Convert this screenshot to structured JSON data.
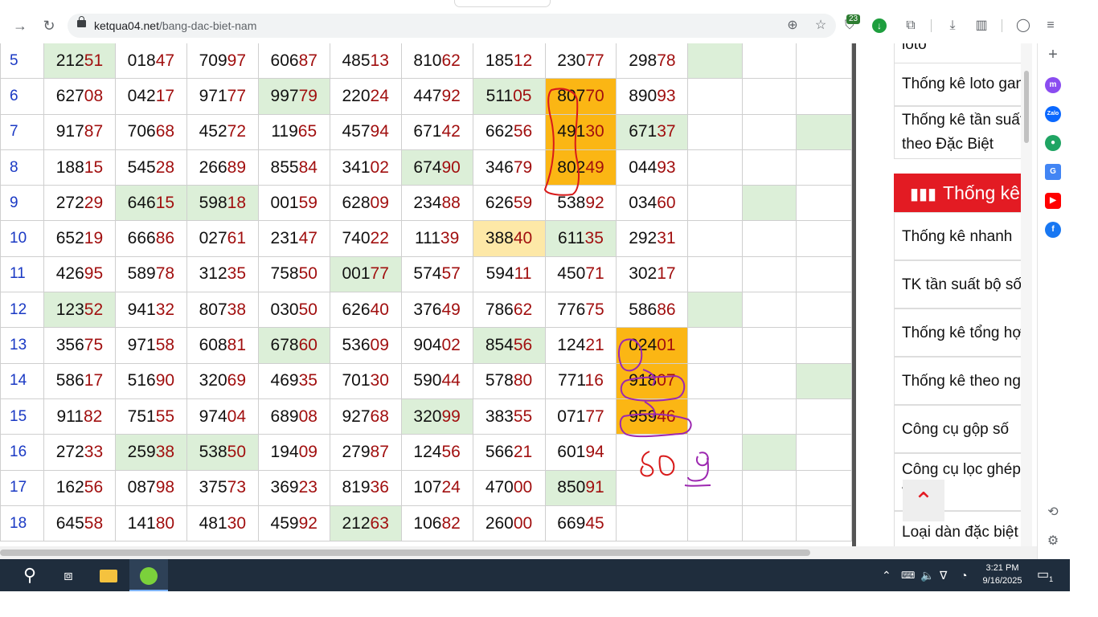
{
  "browser": {
    "url_host": "ketqua04.net",
    "url_path": "/bang-dac-biet-nam",
    "extension_badge": "23"
  },
  "table": {
    "rows": [
      {
        "no": "5",
        "cells": [
          {
            "head": "212",
            "tail": "51",
            "bg": "g"
          },
          {
            "head": "018",
            "tail": "47"
          },
          {
            "head": "709",
            "tail": "97"
          },
          {
            "head": "606",
            "tail": "87"
          },
          {
            "head": "485",
            "tail": "13"
          },
          {
            "head": "810",
            "tail": "62"
          },
          {
            "head": "185",
            "tail": "12"
          },
          {
            "head": "230",
            "tail": "77"
          },
          {
            "head": "298",
            "tail": "78"
          },
          {
            "head": "",
            "tail": "",
            "bg": "g"
          },
          {
            "head": "",
            "tail": ""
          },
          {
            "head": "",
            "tail": ""
          }
        ]
      },
      {
        "no": "6",
        "cells": [
          {
            "head": "627",
            "tail": "08"
          },
          {
            "head": "042",
            "tail": "17"
          },
          {
            "head": "971",
            "tail": "77"
          },
          {
            "head": "997",
            "tail": "79",
            "bg": "g"
          },
          {
            "head": "220",
            "tail": "24"
          },
          {
            "head": "447",
            "tail": "92"
          },
          {
            "head": "511",
            "tail": "05",
            "bg": "g"
          },
          {
            "head": "807",
            "tail": "70",
            "bg": "o"
          },
          {
            "head": "890",
            "tail": "93"
          },
          {
            "head": "",
            "tail": ""
          },
          {
            "head": "",
            "tail": ""
          },
          {
            "head": "",
            "tail": ""
          }
        ]
      },
      {
        "no": "7",
        "cells": [
          {
            "head": "917",
            "tail": "87"
          },
          {
            "head": "706",
            "tail": "68"
          },
          {
            "head": "452",
            "tail": "72"
          },
          {
            "head": "119",
            "tail": "65"
          },
          {
            "head": "457",
            "tail": "94"
          },
          {
            "head": "671",
            "tail": "42"
          },
          {
            "head": "662",
            "tail": "56"
          },
          {
            "head": "491",
            "tail": "30",
            "bg": "o"
          },
          {
            "head": "671",
            "tail": "37",
            "bg": "g"
          },
          {
            "head": "",
            "tail": ""
          },
          {
            "head": "",
            "tail": ""
          },
          {
            "head": "",
            "tail": "",
            "bg": "g"
          }
        ]
      },
      {
        "no": "8",
        "cells": [
          {
            "head": "188",
            "tail": "15"
          },
          {
            "head": "545",
            "tail": "28"
          },
          {
            "head": "266",
            "tail": "89"
          },
          {
            "head": "855",
            "tail": "84"
          },
          {
            "head": "341",
            "tail": "02"
          },
          {
            "head": "674",
            "tail": "90",
            "bg": "g"
          },
          {
            "head": "346",
            "tail": "79"
          },
          {
            "head": "802",
            "tail": "49",
            "bg": "o"
          },
          {
            "head": "044",
            "tail": "93"
          },
          {
            "head": "",
            "tail": ""
          },
          {
            "head": "",
            "tail": ""
          },
          {
            "head": "",
            "tail": ""
          }
        ]
      },
      {
        "no": "9",
        "cells": [
          {
            "head": "272",
            "tail": "29"
          },
          {
            "head": "646",
            "tail": "15",
            "bg": "g"
          },
          {
            "head": "598",
            "tail": "18",
            "bg": "g"
          },
          {
            "head": "001",
            "tail": "59"
          },
          {
            "head": "628",
            "tail": "09"
          },
          {
            "head": "234",
            "tail": "88"
          },
          {
            "head": "626",
            "tail": "59"
          },
          {
            "head": "538",
            "tail": "92"
          },
          {
            "head": "034",
            "tail": "60"
          },
          {
            "head": "",
            "tail": ""
          },
          {
            "head": "",
            "tail": "",
            "bg": "g"
          },
          {
            "head": "",
            "tail": ""
          }
        ]
      },
      {
        "no": "10",
        "cells": [
          {
            "head": "652",
            "tail": "19"
          },
          {
            "head": "666",
            "tail": "86"
          },
          {
            "head": "027",
            "tail": "61"
          },
          {
            "head": "231",
            "tail": "47"
          },
          {
            "head": "740",
            "tail": "22"
          },
          {
            "head": "111",
            "tail": "39"
          },
          {
            "head": "388",
            "tail": "40",
            "bg": "y"
          },
          {
            "head": "611",
            "tail": "35",
            "bg": "g"
          },
          {
            "head": "292",
            "tail": "31"
          },
          {
            "head": "",
            "tail": ""
          },
          {
            "head": "",
            "tail": ""
          },
          {
            "head": "",
            "tail": ""
          }
        ]
      },
      {
        "no": "11",
        "cells": [
          {
            "head": "426",
            "tail": "95"
          },
          {
            "head": "589",
            "tail": "78"
          },
          {
            "head": "312",
            "tail": "35"
          },
          {
            "head": "758",
            "tail": "50"
          },
          {
            "head": "001",
            "tail": "77",
            "bg": "g"
          },
          {
            "head": "574",
            "tail": "57"
          },
          {
            "head": "594",
            "tail": "11"
          },
          {
            "head": "450",
            "tail": "71"
          },
          {
            "head": "302",
            "tail": "17"
          },
          {
            "head": "",
            "tail": ""
          },
          {
            "head": "",
            "tail": ""
          },
          {
            "head": "",
            "tail": ""
          }
        ]
      },
      {
        "no": "12",
        "cells": [
          {
            "head": "123",
            "tail": "52",
            "bg": "g"
          },
          {
            "head": "941",
            "tail": "32"
          },
          {
            "head": "807",
            "tail": "38"
          },
          {
            "head": "030",
            "tail": "50"
          },
          {
            "head": "626",
            "tail": "40"
          },
          {
            "head": "376",
            "tail": "49"
          },
          {
            "head": "786",
            "tail": "62"
          },
          {
            "head": "776",
            "tail": "75"
          },
          {
            "head": "586",
            "tail": "86"
          },
          {
            "head": "",
            "tail": "",
            "bg": "g"
          },
          {
            "head": "",
            "tail": ""
          },
          {
            "head": "",
            "tail": ""
          }
        ]
      },
      {
        "no": "13",
        "cells": [
          {
            "head": "356",
            "tail": "75"
          },
          {
            "head": "971",
            "tail": "58"
          },
          {
            "head": "608",
            "tail": "81"
          },
          {
            "head": "678",
            "tail": "60",
            "bg": "g"
          },
          {
            "head": "536",
            "tail": "09"
          },
          {
            "head": "904",
            "tail": "02"
          },
          {
            "head": "854",
            "tail": "56",
            "bg": "g"
          },
          {
            "head": "124",
            "tail": "21"
          },
          {
            "head": "024",
            "tail": "01",
            "bg": "o"
          },
          {
            "head": "",
            "tail": ""
          },
          {
            "head": "",
            "tail": ""
          },
          {
            "head": "",
            "tail": ""
          }
        ]
      },
      {
        "no": "14",
        "cells": [
          {
            "head": "586",
            "tail": "17"
          },
          {
            "head": "516",
            "tail": "90"
          },
          {
            "head": "320",
            "tail": "69"
          },
          {
            "head": "469",
            "tail": "35"
          },
          {
            "head": "701",
            "tail": "30"
          },
          {
            "head": "590",
            "tail": "44"
          },
          {
            "head": "578",
            "tail": "80"
          },
          {
            "head": "771",
            "tail": "16"
          },
          {
            "head": "918",
            "tail": "07",
            "bg": "o"
          },
          {
            "head": "",
            "tail": ""
          },
          {
            "head": "",
            "tail": ""
          },
          {
            "head": "",
            "tail": "",
            "bg": "g"
          }
        ]
      },
      {
        "no": "15",
        "cells": [
          {
            "head": "911",
            "tail": "82"
          },
          {
            "head": "751",
            "tail": "55"
          },
          {
            "head": "974",
            "tail": "04"
          },
          {
            "head": "689",
            "tail": "08"
          },
          {
            "head": "927",
            "tail": "68"
          },
          {
            "head": "320",
            "tail": "99",
            "bg": "g"
          },
          {
            "head": "383",
            "tail": "55"
          },
          {
            "head": "071",
            "tail": "77"
          },
          {
            "head": "959",
            "tail": "46",
            "bg": "o"
          },
          {
            "head": "",
            "tail": ""
          },
          {
            "head": "",
            "tail": ""
          },
          {
            "head": "",
            "tail": ""
          }
        ]
      },
      {
        "no": "16",
        "cells": [
          {
            "head": "272",
            "tail": "33"
          },
          {
            "head": "259",
            "tail": "38",
            "bg": "g"
          },
          {
            "head": "538",
            "tail": "50",
            "bg": "g"
          },
          {
            "head": "194",
            "tail": "09"
          },
          {
            "head": "279",
            "tail": "87"
          },
          {
            "head": "124",
            "tail": "56"
          },
          {
            "head": "566",
            "tail": "21"
          },
          {
            "head": "601",
            "tail": "94"
          },
          {
            "head": "",
            "tail": ""
          },
          {
            "head": "",
            "tail": ""
          },
          {
            "head": "",
            "tail": "",
            "bg": "g"
          },
          {
            "head": "",
            "tail": ""
          }
        ]
      },
      {
        "no": "17",
        "cells": [
          {
            "head": "162",
            "tail": "56"
          },
          {
            "head": "087",
            "tail": "98"
          },
          {
            "head": "375",
            "tail": "73"
          },
          {
            "head": "369",
            "tail": "23"
          },
          {
            "head": "819",
            "tail": "36"
          },
          {
            "head": "107",
            "tail": "24"
          },
          {
            "head": "470",
            "tail": "00"
          },
          {
            "head": "850",
            "tail": "91",
            "bg": "g"
          },
          {
            "head": "",
            "tail": ""
          },
          {
            "head": "",
            "tail": ""
          },
          {
            "head": "",
            "tail": ""
          },
          {
            "head": "",
            "tail": ""
          }
        ]
      },
      {
        "no": "18",
        "cells": [
          {
            "head": "645",
            "tail": "58"
          },
          {
            "head": "141",
            "tail": "80"
          },
          {
            "head": "481",
            "tail": "30"
          },
          {
            "head": "459",
            "tail": "92"
          },
          {
            "head": "212",
            "tail": "63",
            "bg": "g"
          },
          {
            "head": "106",
            "tail": "82"
          },
          {
            "head": "260",
            "tail": "00"
          },
          {
            "head": "669",
            "tail": "45"
          },
          {
            "head": "",
            "tail": ""
          },
          {
            "head": "",
            "tail": ""
          },
          {
            "head": "",
            "tail": ""
          },
          {
            "head": "",
            "tail": ""
          }
        ]
      }
    ]
  },
  "sidebar": {
    "items": [
      {
        "label": "loto"
      },
      {
        "label": "Thống kê loto gan"
      },
      {
        "label": "Thống kê tần suất theo Đặc Biệt"
      },
      {
        "label": "Thống kê"
      },
      {
        "label": "Thống kê nhanh"
      },
      {
        "label": "TK tần suất bộ số"
      },
      {
        "label": "Thống kê tổng hợp"
      },
      {
        "label": "Thống kê theo ngày"
      },
      {
        "label": "Công cụ gộp số"
      },
      {
        "label": "Công cụ lọc ghép VIP"
      },
      {
        "label": "Loại dàn đặc biệt"
      }
    ]
  },
  "taskbar": {
    "time": "3:21 PM",
    "date": "9/16/2025",
    "notification_count": "1"
  },
  "colors": {
    "green_cell": "#dcefd8",
    "orange_cell": "#fbb614",
    "yellow_cell": "#fde8a7",
    "tail_red": "#a10f0f",
    "row_number_blue": "#1a39c4",
    "sidebar_red": "#e31b23",
    "taskbar": "#1f2d3d"
  }
}
